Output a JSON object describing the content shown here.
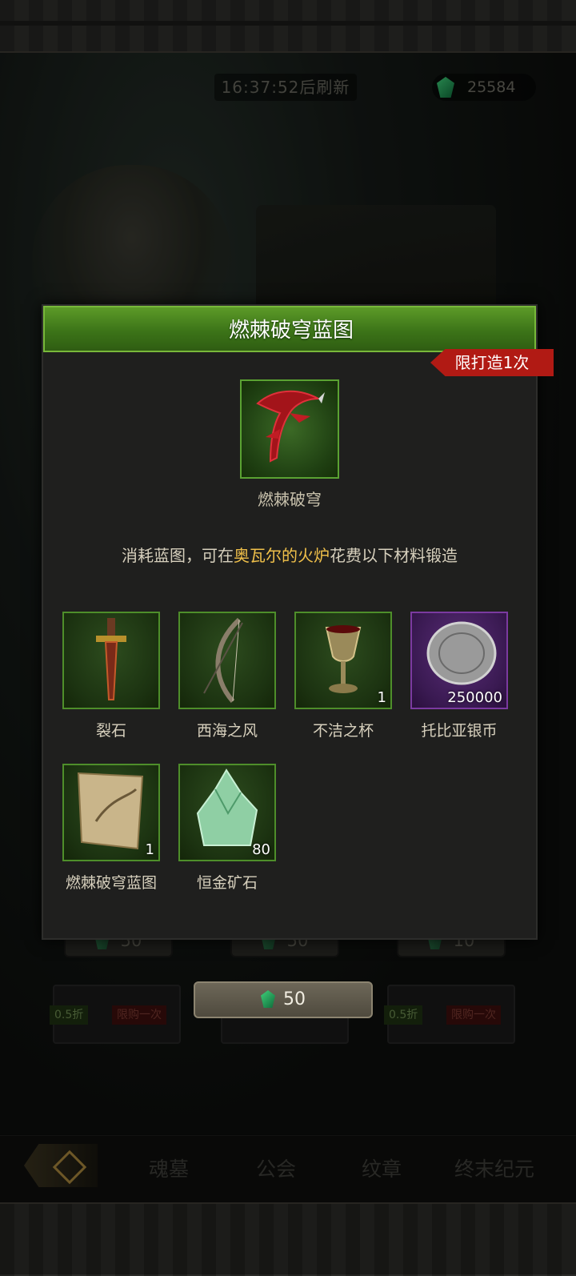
{
  "header": {
    "refresh_timer": "16:37:52后刷新",
    "currency_icon": "emerald-gem-icon",
    "currency_amount": "25584"
  },
  "background_shop": {
    "price_row": [
      "50",
      "50",
      "10"
    ],
    "card_tags": [
      {
        "discount": "0.5折",
        "limit": "限购一次"
      },
      {
        "discount": "0.5折",
        "limit": "限购一次"
      }
    ]
  },
  "modal": {
    "title": "燃棘破穹蓝图",
    "limit_badge": "限打造1次",
    "hero_item_name": "燃棘破穹",
    "description_parts": [
      "消耗蓝图，可在",
      "奥瓦尔的火炉",
      "花费以下材料锻造"
    ],
    "materials": [
      {
        "name": "裂石",
        "count": "",
        "icon": "great-sword-icon"
      },
      {
        "name": "西海之风",
        "count": "",
        "icon": "bow-icon"
      },
      {
        "name": "不洁之杯",
        "count": "1",
        "icon": "goblet-icon"
      },
      {
        "name": "托比亚银币",
        "count": "250000",
        "icon": "silver-coin-icon"
      },
      {
        "name": "燃棘破穹蓝图",
        "count": "1",
        "icon": "blueprint-scroll-icon"
      },
      {
        "name": "恒金矿石",
        "count": "80",
        "icon": "ore-crystal-icon"
      }
    ]
  },
  "buy_button": {
    "price": "50"
  },
  "bottom_nav": {
    "tabs": [
      "魂墓",
      "公会",
      "纹章",
      "终末纪元"
    ]
  },
  "colors": {
    "header_green": "#4c8a22",
    "badge_red": "#b11a14",
    "highlight_gold": "#f0c04a",
    "coin_purple": "#5a2d78"
  }
}
